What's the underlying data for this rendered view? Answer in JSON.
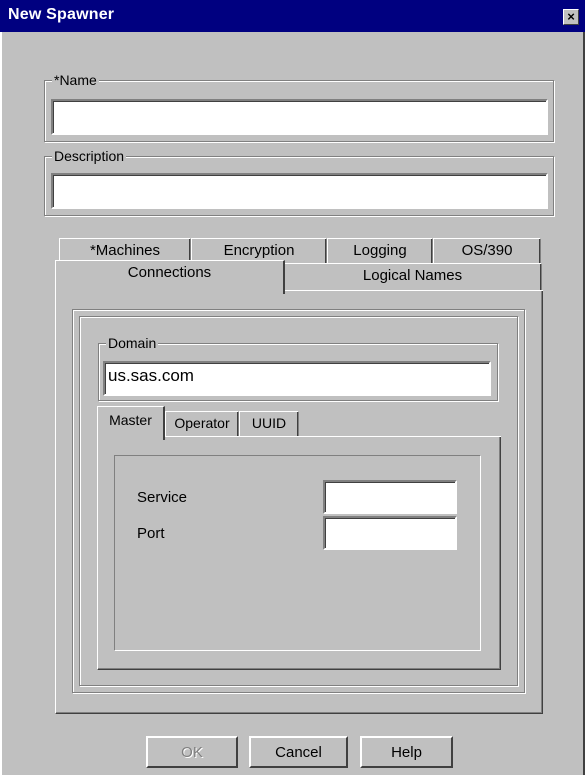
{
  "window": {
    "title": "New Spawner"
  },
  "name_group": {
    "label": "*Name",
    "value": ""
  },
  "description_group": {
    "label": "Description",
    "value": ""
  },
  "tabs_back": [
    "*Machines",
    "Encryption",
    "Logging",
    "OS/390"
  ],
  "tabs_front": [
    "Connections",
    "Logical Names"
  ],
  "domain_group": {
    "label": "Domain",
    "value": "us.sas.com"
  },
  "inner_tabs": [
    "Master",
    "Operator",
    "UUID"
  ],
  "service_label": "Service",
  "port_label": "Port",
  "buttons": {
    "ok": "OK",
    "cancel": "Cancel",
    "help": "Help"
  }
}
